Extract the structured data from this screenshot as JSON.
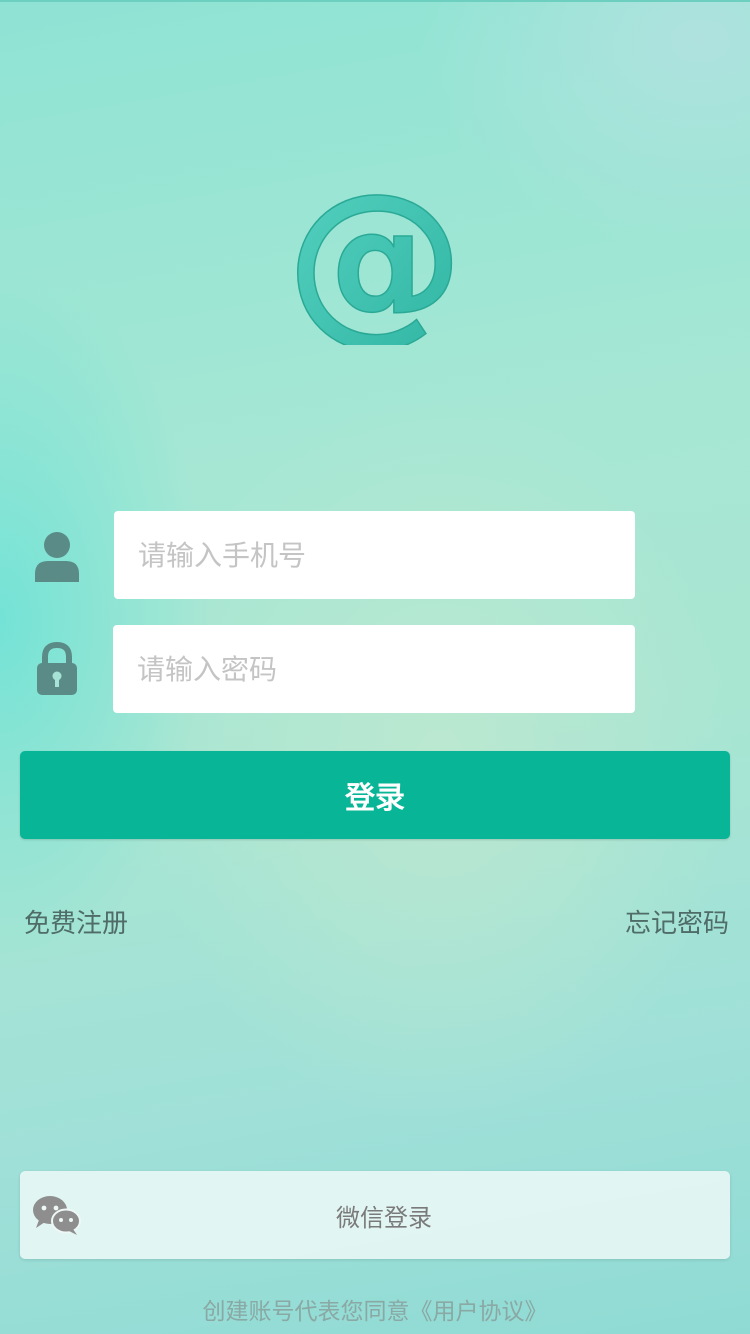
{
  "colors": {
    "accent": "#08b596",
    "icon": "#5b8b86",
    "logo": "#3fc3b0",
    "link_text": "#4f6c68"
  },
  "logo": {
    "icon": "at-sign-icon"
  },
  "form": {
    "phone": {
      "icon": "user-icon",
      "placeholder": "请输入手机号",
      "value": ""
    },
    "password": {
      "icon": "lock-icon",
      "placeholder": "请输入密码",
      "value": ""
    }
  },
  "login_button": {
    "label": "登录"
  },
  "links": {
    "register": "免费注册",
    "forgot": "忘记密码"
  },
  "wechat": {
    "icon": "wechat-icon",
    "label": "微信登录"
  },
  "agreement": {
    "text": "创建账号代表您同意《用户协议》"
  }
}
